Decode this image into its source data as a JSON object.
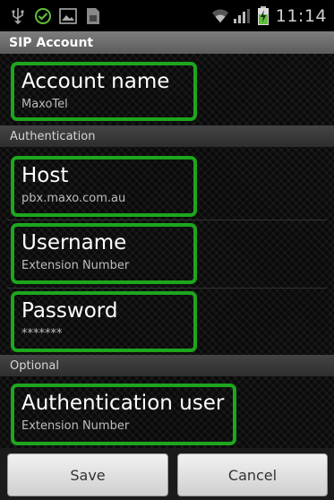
{
  "status_bar": {
    "time": "11:14",
    "icons": [
      "usb-icon",
      "check-circle-icon",
      "image-icon",
      "sim-card-icon",
      "wifi-icon",
      "signal-icon",
      "battery-charging-icon"
    ]
  },
  "title_bar": {
    "title": "SIP Account"
  },
  "preferences": {
    "account_name": {
      "title": "Account name",
      "summary": "MaxoTel"
    },
    "authentication_header": "Authentication",
    "host": {
      "title": "Host",
      "summary": "pbx.maxo.com.au"
    },
    "username": {
      "title": "Username",
      "summary": "Extension Number"
    },
    "password": {
      "title": "Password",
      "summary": "*******"
    },
    "optional_header": "Optional",
    "auth_user": {
      "title": "Authentication user",
      "summary": "Extension Number"
    }
  },
  "buttons": {
    "save": "Save",
    "cancel": "Cancel"
  },
  "colors": {
    "highlight": "#1da61d",
    "accent_status": "#33b5e5"
  }
}
